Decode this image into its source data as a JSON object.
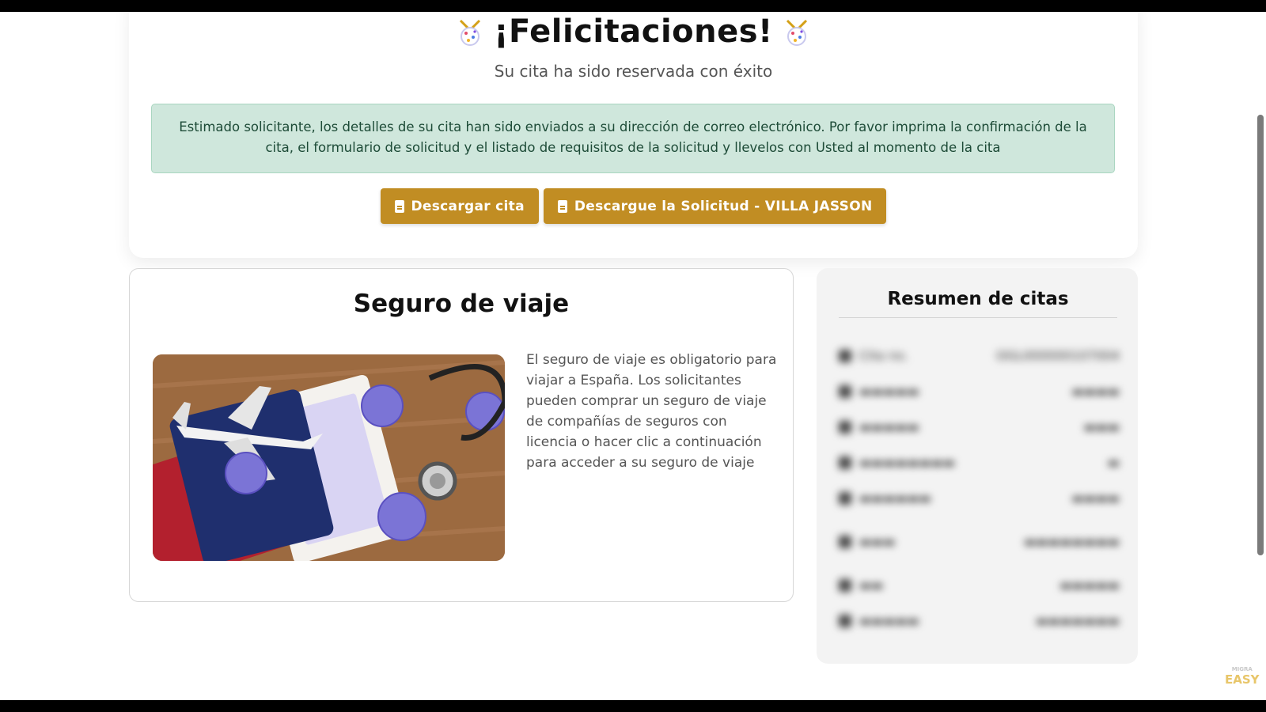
{
  "header": {
    "title": "¡Felicitaciones!",
    "subtitle": "Su cita ha sido reservada con éxito"
  },
  "alert": {
    "message": "Estimado solicitante, los detalles de su cita han sido enviados a su dirección de correo electrónico. Por favor imprima la confirmación de la cita, el formulario de solicitud y el listado de requisitos de la solicitud y llevelos con Usted al momento de la cita"
  },
  "buttons": {
    "download_appointment": "Descargar cita",
    "download_application": "Descargue la Solicitud - VILLA JASSON"
  },
  "insurance": {
    "title": "Seguro de viaje",
    "text": "El seguro de viaje es obligatorio para viajar a España. Los solicitantes pueden comprar un seguro de viaje de compañías de seguros con licencia o hacer clic a continuación para acceder a su seguro de viaje"
  },
  "summary": {
    "title": "Resumen de citas",
    "rows": [
      {
        "label": "Cita no.",
        "value": "OGL000000107004"
      }
    ]
  },
  "watermark": {
    "top": "MIGRA",
    "bottom": "EASY"
  },
  "colors": {
    "accent_button": "#c18d23",
    "alert_bg": "#cfe7dc",
    "alert_text": "#1d4b37"
  }
}
